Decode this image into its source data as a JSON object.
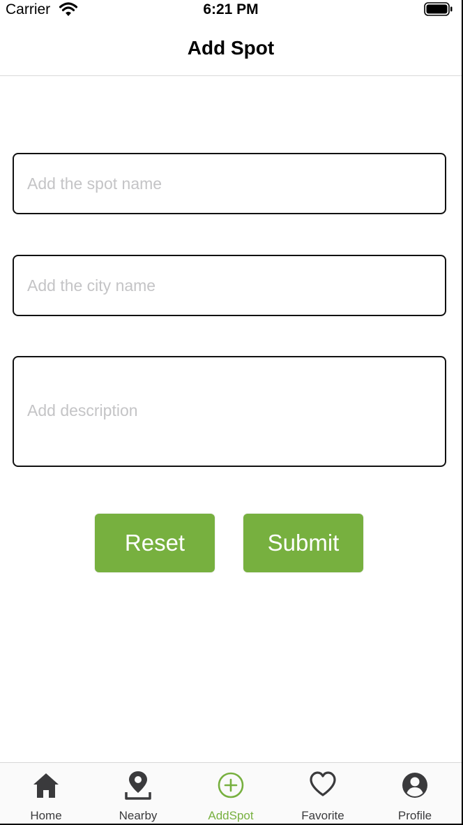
{
  "status_bar": {
    "carrier": "Carrier",
    "time": "6:21 PM"
  },
  "header": {
    "title": "Add Spot"
  },
  "form": {
    "spot_name_placeholder": "Add the spot name",
    "city_name_placeholder": "Add the city name",
    "description_placeholder": "Add description",
    "reset_label": "Reset",
    "submit_label": "Submit"
  },
  "tabs": [
    {
      "label": "Home",
      "icon": "home-icon"
    },
    {
      "label": "Nearby",
      "icon": "map-pin-icon"
    },
    {
      "label": "AddSpot",
      "icon": "plus-circle-icon",
      "active": true
    },
    {
      "label": "Favorite",
      "icon": "heart-icon"
    },
    {
      "label": "Profile",
      "icon": "user-circle-icon"
    }
  ],
  "colors": {
    "accent": "#77b03f",
    "icon": "#3a3a3c"
  }
}
